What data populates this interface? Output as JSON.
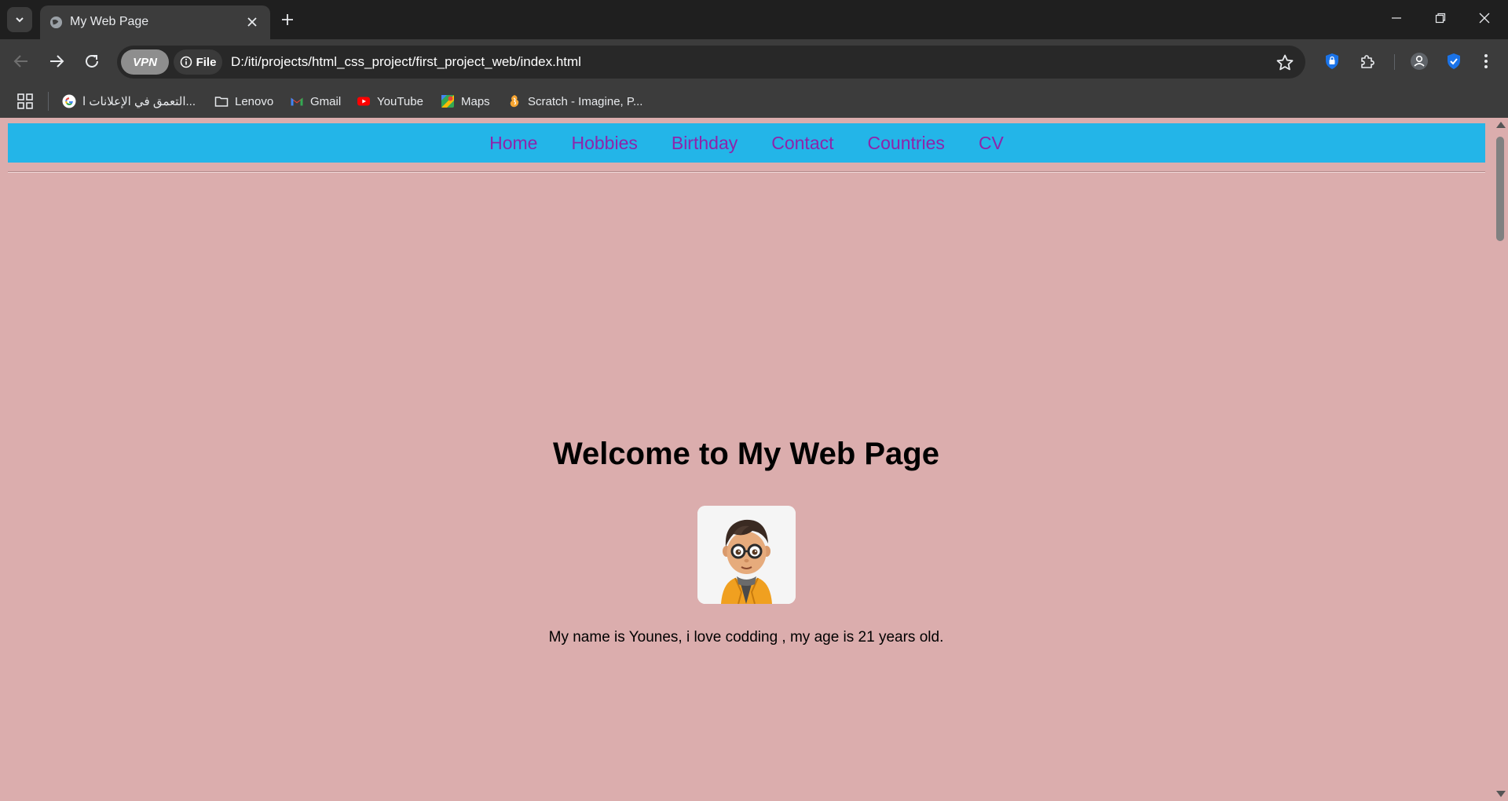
{
  "browser": {
    "tab": {
      "title": "My Web Page"
    },
    "address": {
      "chip_vpn": "VPN",
      "chip_file": "File",
      "url": "D:/iti/projects/html_css_project/first_project_web/index.html"
    },
    "bookmarks": [
      {
        "label": "التعمق في الإعلانات ا...",
        "icon": "google-icon"
      },
      {
        "label": "Lenovo",
        "icon": "folder-icon"
      },
      {
        "label": "Gmail",
        "icon": "gmail-icon"
      },
      {
        "label": "YouTube",
        "icon": "youtube-icon"
      },
      {
        "label": "Maps",
        "icon": "maps-icon"
      },
      {
        "label": "Scratch - Imagine, P...",
        "icon": "scratch-icon"
      }
    ]
  },
  "page": {
    "nav": [
      "Home",
      "Hobbies",
      "Birthday",
      "Contact",
      "Countries",
      "CV"
    ],
    "heading": "Welcome to My Web Page",
    "bio": "My name is Younes, i love codding , my age is 21 years old.",
    "colors": {
      "background": "#dbadad",
      "navbar": "#23b5e8",
      "link": "#8e24aa"
    }
  }
}
